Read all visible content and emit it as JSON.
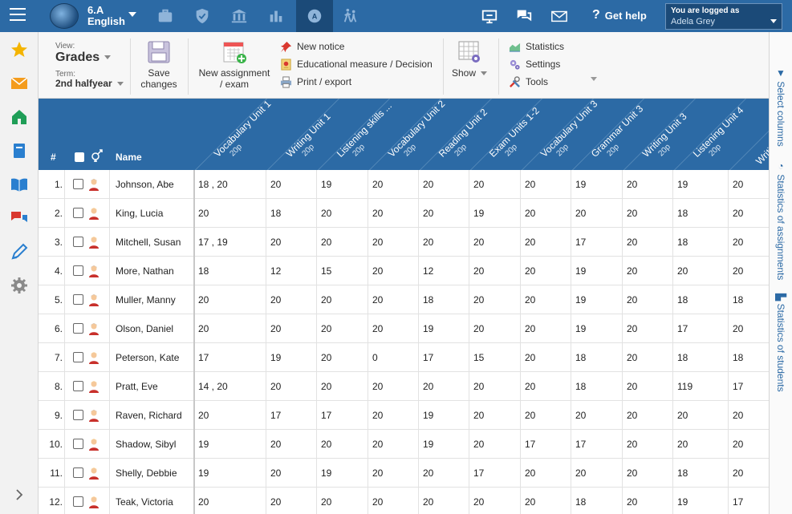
{
  "topbar": {
    "class_code": "6.A",
    "class_subject": "English",
    "help_label": "Get help",
    "logged_label": "You are logged as",
    "user_name": "Adela Grey"
  },
  "toolbar": {
    "view_label": "View:",
    "view_value": "Grades",
    "term_label": "Term:",
    "term_value": "2nd halfyear",
    "save_label_1": "Save",
    "save_label_2": "changes",
    "new_assignment_1": "New assignment",
    "new_assignment_2": "/ exam",
    "new_notice": "New notice",
    "educational_measure": "Educational measure / Decision",
    "print_export": "Print / export",
    "show": "Show",
    "statistics": "Statistics",
    "settings": "Settings",
    "tools": "Tools"
  },
  "rightbar": {
    "select_columns": "Select columns",
    "stats_assignments": "Statistics of assignments",
    "stats_students": "Statistics of students"
  },
  "table": {
    "h_num": "#",
    "h_name": "Name",
    "columns": [
      {
        "label": "Vocabulary Unit 1",
        "points": "20p"
      },
      {
        "label": "Writing Unit 1",
        "points": "20p"
      },
      {
        "label": "Listening skills ...",
        "points": "20p"
      },
      {
        "label": "Vocabulary Unit 2",
        "points": "20p"
      },
      {
        "label": "Reading Unit 2",
        "points": "20p"
      },
      {
        "label": "Exam Units 1-2",
        "points": "20p"
      },
      {
        "label": "Vocabulary Unit 3",
        "points": "20p"
      },
      {
        "label": "Grammar Unit 3",
        "points": "20p"
      },
      {
        "label": "Writing Unit 3",
        "points": "20p"
      },
      {
        "label": "Listening Unit 4",
        "points": "20p"
      },
      {
        "label": "Writi",
        "points": ""
      }
    ],
    "rows": [
      {
        "num": "1.",
        "name": "Johnson, Abe",
        "gender": "m",
        "grades": [
          "18 ,   20",
          "20",
          "19",
          "20",
          "20",
          "20",
          "20",
          "19",
          "20",
          "19",
          "20"
        ]
      },
      {
        "num": "2.",
        "name": "King, Lucia",
        "gender": "f",
        "grades": [
          "20",
          "18",
          "20",
          "20",
          "20",
          "19",
          "20",
          "20",
          "20",
          "18",
          "20"
        ]
      },
      {
        "num": "3.",
        "name": "Mitchell, Susan",
        "gender": "f",
        "grades": [
          "17 ,   19",
          "20",
          "20",
          "20",
          "20",
          "20",
          "20",
          "17",
          "20",
          "18",
          "20"
        ]
      },
      {
        "num": "4.",
        "name": "More, Nathan",
        "gender": "m",
        "grades": [
          "18",
          "12",
          "15",
          "20",
          "12",
          "20",
          "20",
          "19",
          "20",
          "20",
          "20"
        ]
      },
      {
        "num": "5.",
        "name": "Muller, Manny",
        "gender": "m",
        "grades": [
          "20",
          "20",
          "20",
          "20",
          "18",
          "20",
          "20",
          "19",
          "20",
          "18",
          "18"
        ]
      },
      {
        "num": "6.",
        "name": "Olson, Daniel",
        "gender": "m",
        "grades": [
          "20",
          "20",
          "20",
          "20",
          "19",
          "20",
          "20",
          "19",
          "20",
          "17",
          "20"
        ]
      },
      {
        "num": "7.",
        "name": "Peterson, Kate",
        "gender": "f",
        "grades": [
          "17",
          "19",
          "20",
          "0",
          "17",
          "15",
          "20",
          "18",
          "20",
          "18",
          "18"
        ]
      },
      {
        "num": "8.",
        "name": "Pratt, Eve",
        "gender": "f",
        "grades": [
          "14 ,   20",
          "20",
          "20",
          "20",
          "20",
          "20",
          "20",
          "18",
          "20",
          "119",
          "17"
        ]
      },
      {
        "num": "9.",
        "name": "Raven, Richard",
        "gender": "m",
        "grades": [
          "20",
          "17",
          "17",
          "20",
          "19",
          "20",
          "20",
          "20",
          "20",
          "20",
          "20"
        ]
      },
      {
        "num": "10.",
        "name": "Shadow, Sibyl",
        "gender": "f",
        "grades": [
          "19",
          "20",
          "20",
          "20",
          "19",
          "20",
          "17",
          "17",
          "20",
          "20",
          "20"
        ]
      },
      {
        "num": "11.",
        "name": "Shelly, Debbie",
        "gender": "f",
        "grades": [
          "19",
          "20",
          "19",
          "20",
          "20",
          "17",
          "20",
          "20",
          "20",
          "18",
          "20"
        ]
      },
      {
        "num": "12.",
        "name": "Teak, Victoria",
        "gender": "f",
        "grades": [
          "20",
          "20",
          "20",
          "20",
          "20",
          "20",
          "20",
          "18",
          "20",
          "19",
          "17"
        ]
      }
    ]
  }
}
